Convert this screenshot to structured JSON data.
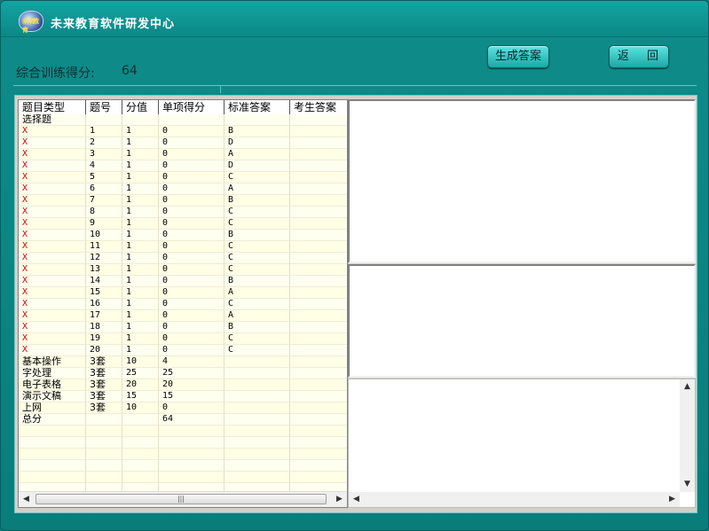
{
  "app": {
    "title": "未来教育软件研发中心",
    "logo_text": "未来教育"
  },
  "score": {
    "label": "综合训练得分:",
    "value": "64"
  },
  "buttons": {
    "generate": "生成答案",
    "back": "返 回"
  },
  "table": {
    "columns": [
      "题目类型",
      "题号",
      "分值",
      "单项得分",
      "标准答案",
      "考生答案"
    ],
    "rows": [
      [
        "选择题",
        "",
        "",
        "",
        "",
        ""
      ],
      [
        "X",
        "1",
        "1",
        "0",
        "B",
        ""
      ],
      [
        "X",
        "2",
        "1",
        "0",
        "D",
        ""
      ],
      [
        "X",
        "3",
        "1",
        "0",
        "A",
        ""
      ],
      [
        "X",
        "4",
        "1",
        "0",
        "D",
        ""
      ],
      [
        "X",
        "5",
        "1",
        "0",
        "C",
        ""
      ],
      [
        "X",
        "6",
        "1",
        "0",
        "A",
        ""
      ],
      [
        "X",
        "7",
        "1",
        "0",
        "B",
        ""
      ],
      [
        "X",
        "8",
        "1",
        "0",
        "C",
        ""
      ],
      [
        "X",
        "9",
        "1",
        "0",
        "C",
        ""
      ],
      [
        "X",
        "10",
        "1",
        "0",
        "B",
        ""
      ],
      [
        "X",
        "11",
        "1",
        "0",
        "C",
        ""
      ],
      [
        "X",
        "12",
        "1",
        "0",
        "C",
        ""
      ],
      [
        "X",
        "13",
        "1",
        "0",
        "C",
        ""
      ],
      [
        "X",
        "14",
        "1",
        "0",
        "B",
        ""
      ],
      [
        "X",
        "15",
        "1",
        "0",
        "A",
        ""
      ],
      [
        "X",
        "16",
        "1",
        "0",
        "C",
        ""
      ],
      [
        "X",
        "17",
        "1",
        "0",
        "A",
        ""
      ],
      [
        "X",
        "18",
        "1",
        "0",
        "B",
        ""
      ],
      [
        "X",
        "19",
        "1",
        "0",
        "C",
        ""
      ],
      [
        "X",
        "20",
        "1",
        "0",
        "C",
        ""
      ],
      [
        "基本操作",
        "3套",
        "10",
        "4",
        "",
        ""
      ],
      [
        "字处理",
        "3套",
        "25",
        "25",
        "",
        ""
      ],
      [
        "电子表格",
        "3套",
        "20",
        "20",
        "",
        ""
      ],
      [
        "演示文稿",
        "3套",
        "15",
        "15",
        "",
        ""
      ],
      [
        "上网",
        "3套",
        "10",
        "0",
        "",
        ""
      ],
      [
        "总分",
        "",
        "",
        "64",
        "",
        ""
      ]
    ],
    "blank_rows": 6
  },
  "colors": {
    "wrong": "#dd0000",
    "titlebar": "#0b8886",
    "window": "#0e8c8a"
  }
}
